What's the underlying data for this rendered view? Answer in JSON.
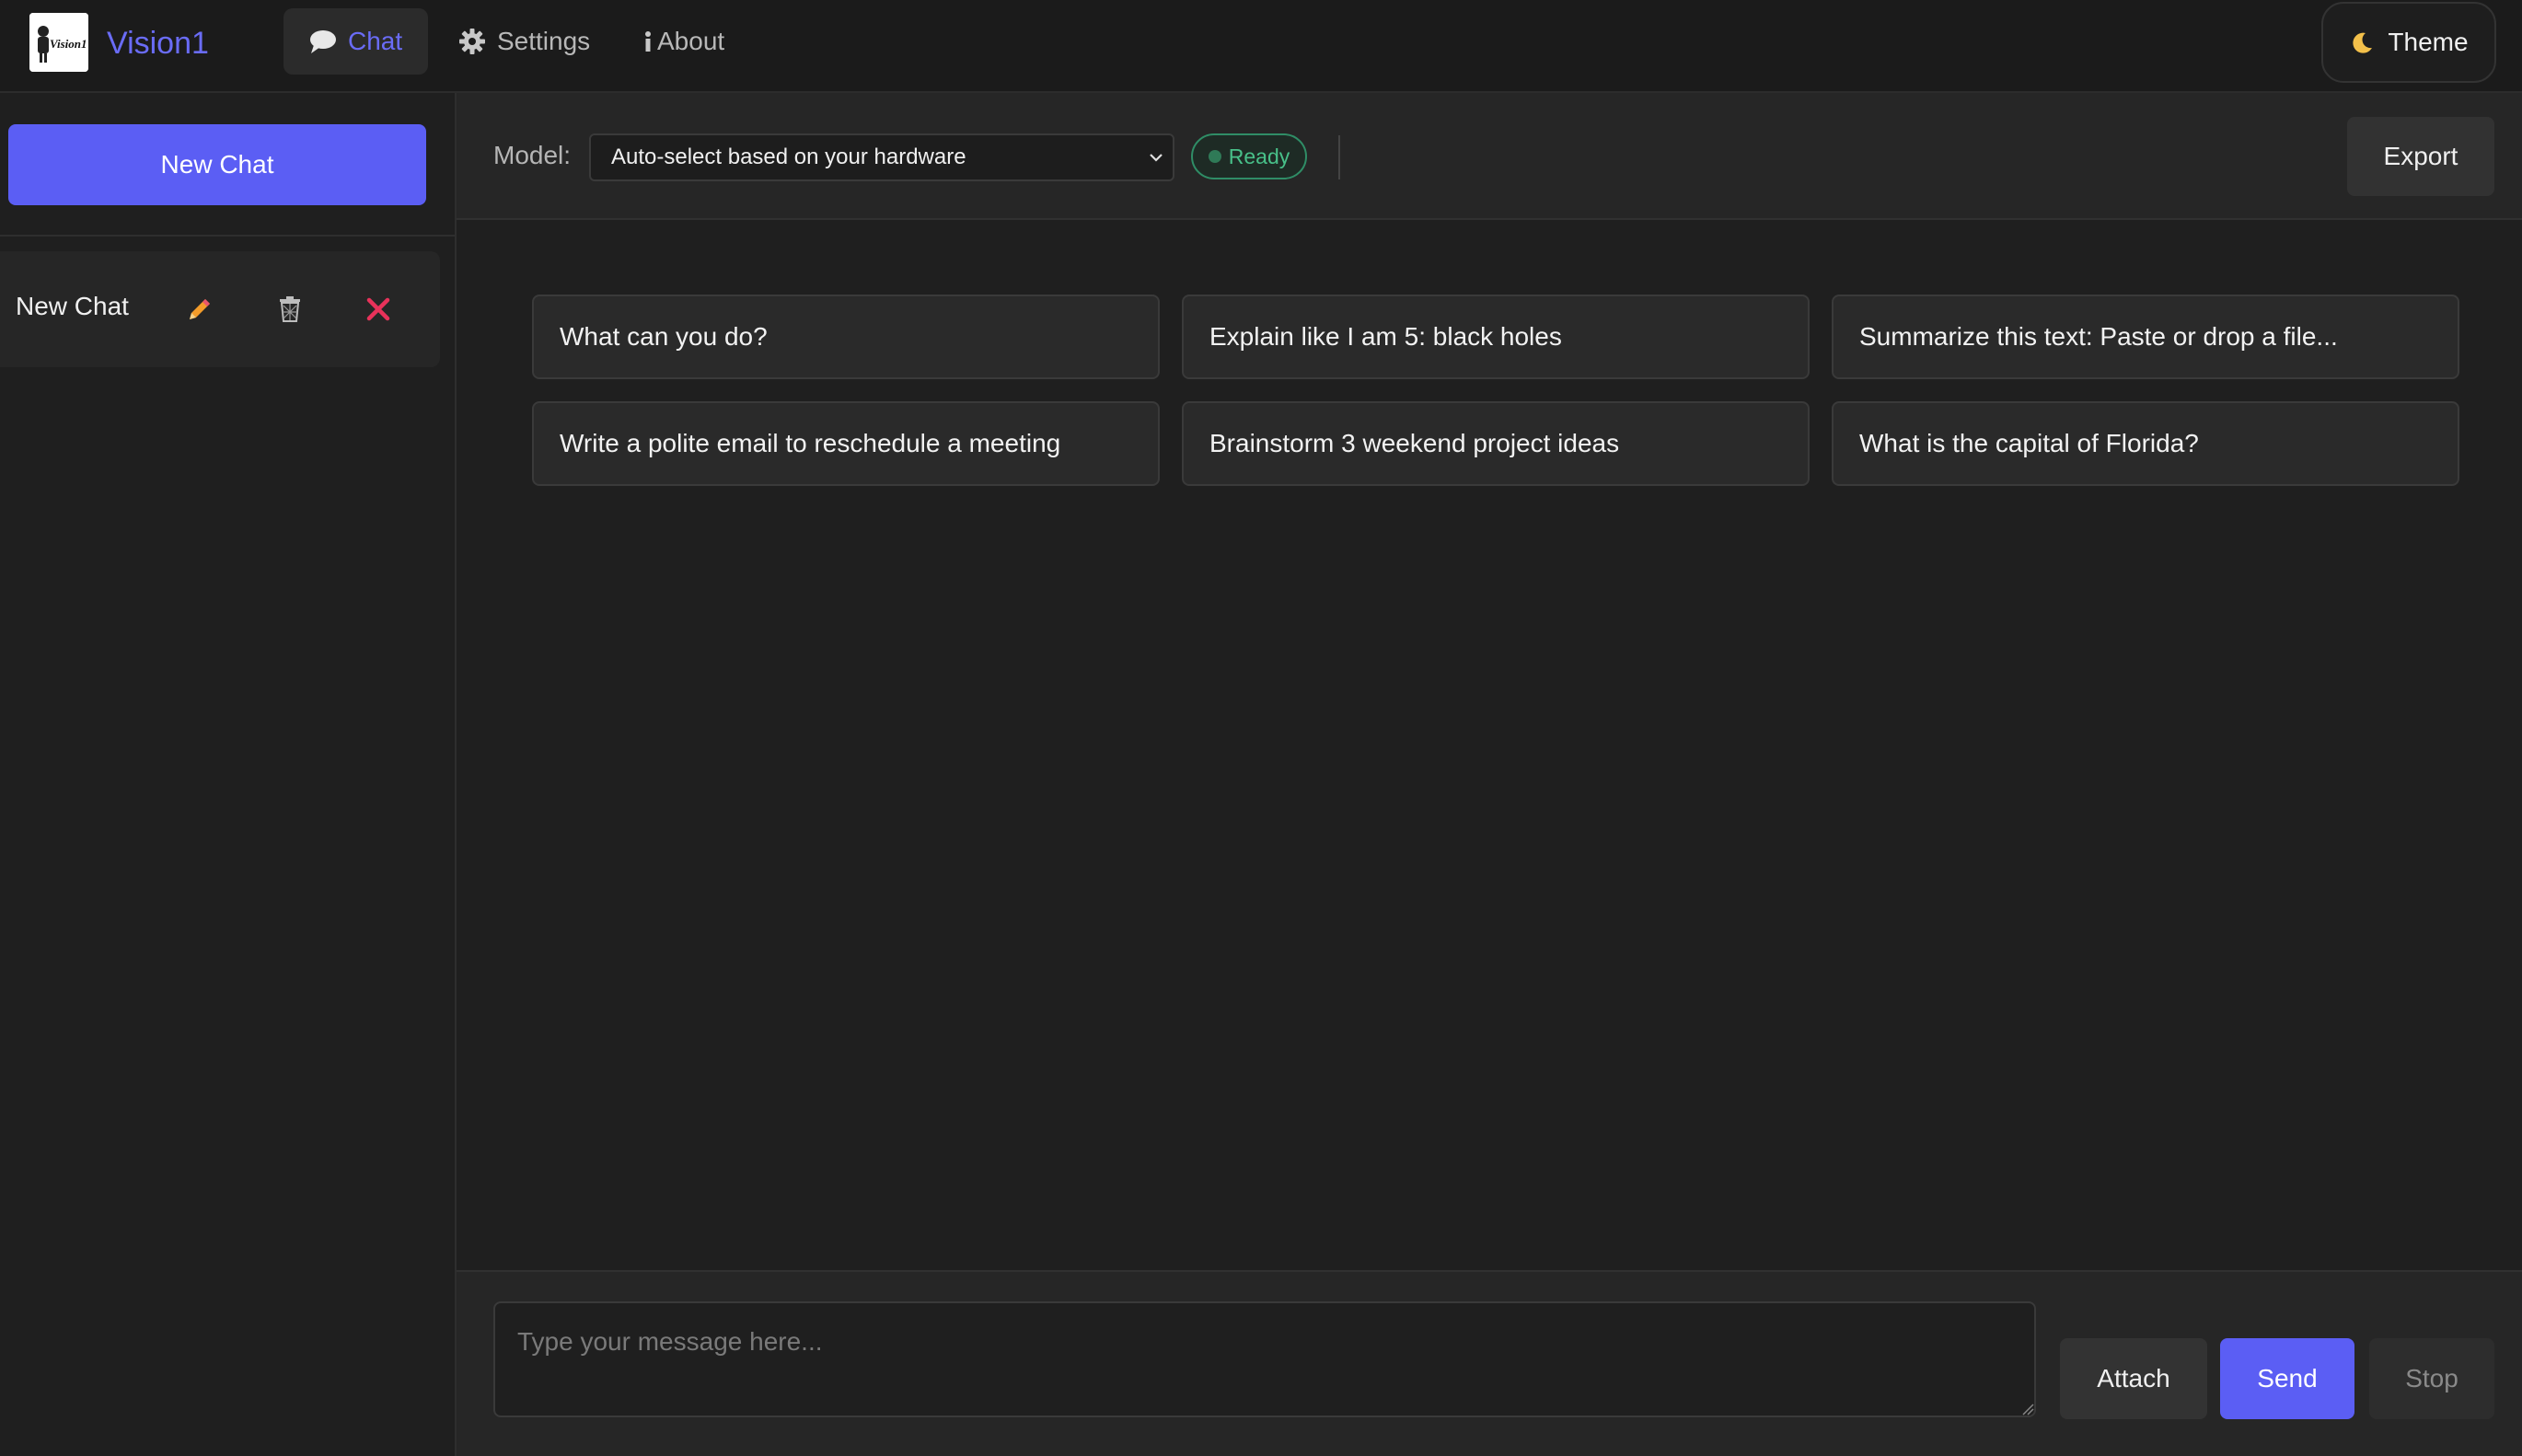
{
  "app": {
    "name": "Vision1",
    "logo_text": "Vision1"
  },
  "nav": {
    "tabs": [
      {
        "label": "Chat",
        "icon": "chat-bubble-icon",
        "active": true
      },
      {
        "label": "Settings",
        "icon": "gear-icon",
        "active": false
      },
      {
        "label": "About",
        "icon": "info-icon",
        "active": false
      }
    ],
    "theme_label": "Theme",
    "theme_icon": "moon-icon"
  },
  "sidebar": {
    "new_chat_label": "New Chat",
    "chats": [
      {
        "title": "New Chat",
        "actions": [
          "pencil-icon",
          "trash-icon",
          "close-icon"
        ]
      }
    ]
  },
  "header": {
    "model_label": "Model:",
    "model_value": "Auto-select based on your hardware",
    "status": "Ready",
    "export_label": "Export"
  },
  "suggestions": [
    "What can you do?",
    "Explain like I am 5: black holes",
    "Summarize this text: Paste or drop a file...",
    "Write a polite email to reschedule a meeting",
    "Brainstorm 3 weekend project ideas",
    "What is the capital of Florida?"
  ],
  "composer": {
    "placeholder": "Type your message here...",
    "value": "",
    "attach_label": "Attach",
    "send_label": "Send",
    "stop_label": "Stop"
  },
  "colors": {
    "accent": "#5b5ef4",
    "brand_text": "#6a6cf6",
    "status_green": "#48c089",
    "danger": "#e8325a",
    "pencil": "#f39c2a"
  }
}
